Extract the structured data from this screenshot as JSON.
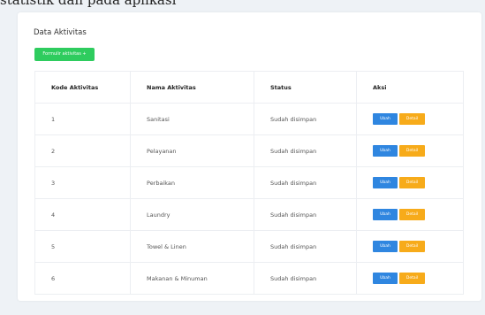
{
  "caption": "statistik dan pada aplikasi",
  "card": {
    "title": "Data Aktivitas",
    "add_button": "Formulir aktivitas +"
  },
  "table": {
    "headers": [
      "Kode Aktivitas",
      "Nama Aktivitas",
      "Status",
      "Aksi"
    ],
    "rows": [
      {
        "kode": "1",
        "nama": "Sanitasi",
        "status": "Sudah disimpan"
      },
      {
        "kode": "2",
        "nama": "Pelayanan",
        "status": "Sudah disimpan"
      },
      {
        "kode": "3",
        "nama": "Perbaikan",
        "status": "Sudah disimpan"
      },
      {
        "kode": "4",
        "nama": "Laundry",
        "status": "Sudah disimpan"
      },
      {
        "kode": "5",
        "nama": "Towel & Linen",
        "status": "Sudah disimpan"
      },
      {
        "kode": "6",
        "nama": "Makanan & Minuman",
        "status": "Sudah disimpan"
      }
    ],
    "edit_label": "Ubah",
    "detail_label": "Detail"
  },
  "colors": {
    "add_button": "#2ecc5e",
    "edit_button": "#2f86e0",
    "detail_button": "#f7ab1a",
    "background": "#eef2f6"
  }
}
